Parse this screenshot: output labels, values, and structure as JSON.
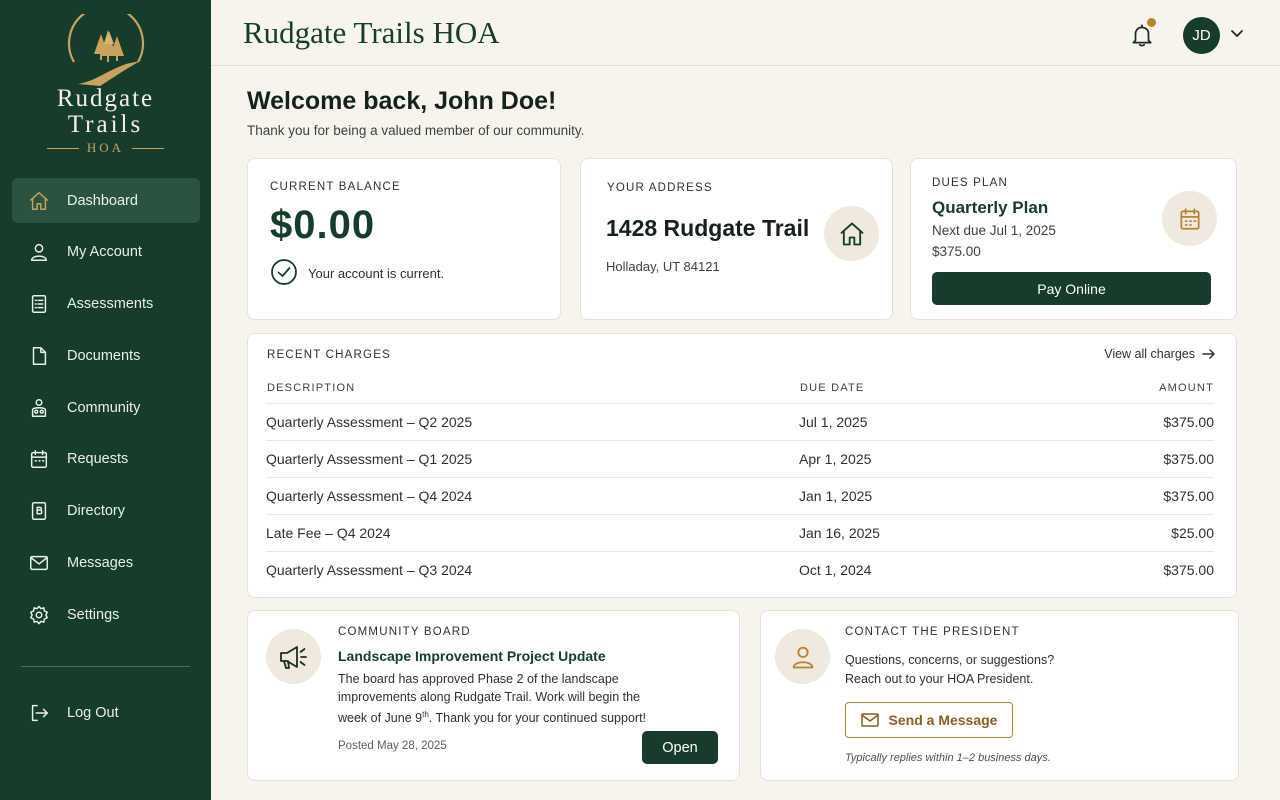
{
  "app": {
    "title": "Rudgate Trails HOA"
  },
  "logo": {
    "line1": "Rudgate",
    "line2": "Trails",
    "line3": "HOA"
  },
  "header": {
    "avatar_initials": "JD",
    "notification_dot_color": "#b8842e"
  },
  "sidebar": {
    "items": [
      {
        "label": "Dashboard",
        "icon": "home-icon",
        "active": true
      },
      {
        "label": "My Account",
        "icon": "user-icon"
      },
      {
        "label": "Assessments",
        "icon": "clipboard-list-icon"
      },
      {
        "label": "Documents",
        "icon": "document-icon"
      },
      {
        "label": "Community",
        "icon": "community-icon"
      },
      {
        "label": "Requests",
        "icon": "calendar-icon"
      },
      {
        "label": "Directory",
        "icon": "directory-book-icon"
      },
      {
        "label": "Messages",
        "icon": "mail-icon"
      },
      {
        "label": "Settings",
        "icon": "gear-icon"
      }
    ],
    "logout_label": "Log Out"
  },
  "welcome": {
    "title": "Welcome back, John Doe!",
    "subtitle": "Thank you for being a valued member of our community."
  },
  "balance": {
    "label": "CURRENT BALANCE",
    "amount": "$0.00",
    "status": "Your account is current."
  },
  "address": {
    "label": "YOUR ADDRESS",
    "line1": "1428 Rudgate Trail",
    "line2": "Holladay, UT 84121"
  },
  "dues": {
    "label": "DUES PLAN",
    "plan": "Quarterly Plan",
    "next_due": "Next due Jul 1, 2025",
    "amount": "$375.00",
    "button": "Pay Online"
  },
  "charges": {
    "label": "RECENT CHARGES",
    "view_all": "View all charges",
    "columns": [
      "DESCRIPTION",
      "DUE DATE",
      "AMOUNT"
    ],
    "rows": [
      {
        "description": "Quarterly Assessment – Q2 2025",
        "due": "Jul 1, 2025",
        "amount": "$375.00"
      },
      {
        "description": "Quarterly Assessment – Q1 2025",
        "due": "Apr 1, 2025",
        "amount": "$375.00"
      },
      {
        "description": "Quarterly Assessment – Q4 2024",
        "due": "Jan 1, 2025",
        "amount": "$375.00"
      },
      {
        "description": "Late Fee – Q4 2024",
        "due": "Jan 16, 2025",
        "amount": "$25.00"
      },
      {
        "description": "Quarterly Assessment – Q3 2024",
        "due": "Oct 1, 2024",
        "amount": "$375.00"
      }
    ]
  },
  "board": {
    "label": "COMMUNITY BOARD",
    "title": "Landscape Improvement Project Update",
    "body_before": "The board has approved Phase 2 of the landscape improvements along Rudgate Trail. Work will begin the week of June 9",
    "body_sup": "th",
    "body_after": ". Thank you for your continued support!",
    "posted": "Posted May 28, 2025",
    "button": "Open"
  },
  "president": {
    "label": "CONTACT THE PRESIDENT",
    "body": "Questions, concerns, or suggestions? Reach out to your HOA President.",
    "button": "Send a Message",
    "note": "Typically replies within 1–2 business days."
  },
  "colors": {
    "primary": "#163d2b",
    "accent": "#c9a25c",
    "background": "#f7f4ee"
  }
}
